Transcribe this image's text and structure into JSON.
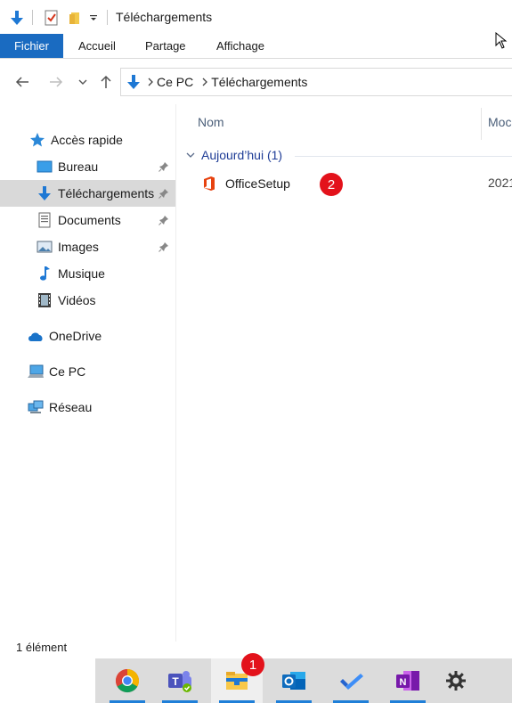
{
  "window": {
    "title": "Téléchargements"
  },
  "ribbon": {
    "tabs": [
      "Fichier",
      "Accueil",
      "Partage",
      "Affichage"
    ]
  },
  "address": {
    "crumbs": [
      "Ce PC",
      "Téléchargements"
    ]
  },
  "sidebar": {
    "items": [
      {
        "label": "Accès rapide",
        "icon": "star-icon"
      },
      {
        "label": "Bureau",
        "icon": "desktop-icon",
        "pinned": true
      },
      {
        "label": "Téléchargements",
        "icon": "download-arrow-icon",
        "pinned": true,
        "selected": true
      },
      {
        "label": "Documents",
        "icon": "document-icon",
        "pinned": true
      },
      {
        "label": "Images",
        "icon": "image-icon",
        "pinned": true
      },
      {
        "label": "Musique",
        "icon": "music-note-icon"
      },
      {
        "label": "Vidéos",
        "icon": "film-icon"
      },
      {
        "label": "OneDrive",
        "icon": "cloud-icon"
      },
      {
        "label": "Ce PC",
        "icon": "computer-icon"
      },
      {
        "label": "Réseau",
        "icon": "network-icon"
      }
    ]
  },
  "content": {
    "columns": [
      "Nom",
      "Moc"
    ],
    "group": "Aujourd’hui (1)",
    "files": [
      {
        "name": "OfficeSetup",
        "icon": "office-icon",
        "date": "2021"
      }
    ]
  },
  "badges": {
    "taskbar_explorer": "1",
    "file_office": "2"
  },
  "status": {
    "count": "1 élément"
  },
  "taskbar": {
    "apps": [
      "chrome-icon",
      "teams-icon",
      "file-explorer-icon",
      "outlook-icon",
      "todo-icon",
      "onenote-icon",
      "settings-gear-icon"
    ]
  },
  "colors": {
    "accent": "#1a6bc1",
    "badge": "#e3121b",
    "group_text": "#1e3c96"
  }
}
